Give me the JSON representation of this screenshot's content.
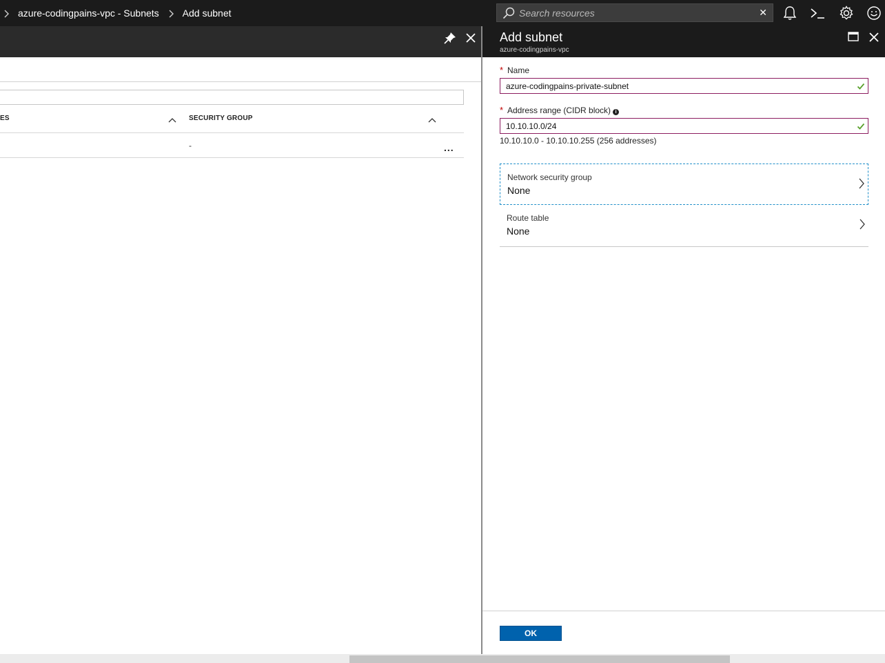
{
  "topbar": {
    "breadcrumbs": [
      "azure-codingpains-vpc - Subnets",
      "Add subnet"
    ],
    "search": {
      "placeholder": "Search resources",
      "value": ""
    },
    "icons": [
      "notifications-bell-icon",
      "cloud-shell-icon",
      "settings-gear-icon",
      "feedback-smiley-icon"
    ]
  },
  "left_blade": {
    "columns": [
      "ES",
      "SECURITY GROUP"
    ],
    "rows": [
      {
        "security_group": "-",
        "more": "..."
      }
    ]
  },
  "right_blade": {
    "title": "Add subnet",
    "subtitle": "azure-codingpains-vpc",
    "name_field": {
      "label": "Name",
      "required": "*",
      "value": "azure-codingpains-private-subnet"
    },
    "address_field": {
      "label": "Address range (CIDR block)",
      "required": "*",
      "value": "10.10.10.0/24",
      "hint": "10.10.10.0 - 10.10.10.255 (256 addresses)"
    },
    "network_security_group": {
      "label": "Network security group",
      "value": "None"
    },
    "route_table": {
      "label": "Route table",
      "value": "None"
    },
    "ok_label": "OK"
  },
  "colors": {
    "topbar_bg": "#1b1b1b",
    "input_border": "#8b1b5f",
    "valid_check": "#5aa02c",
    "primary_button": "#0062ad",
    "focus_outline": "#1f8fc9"
  }
}
